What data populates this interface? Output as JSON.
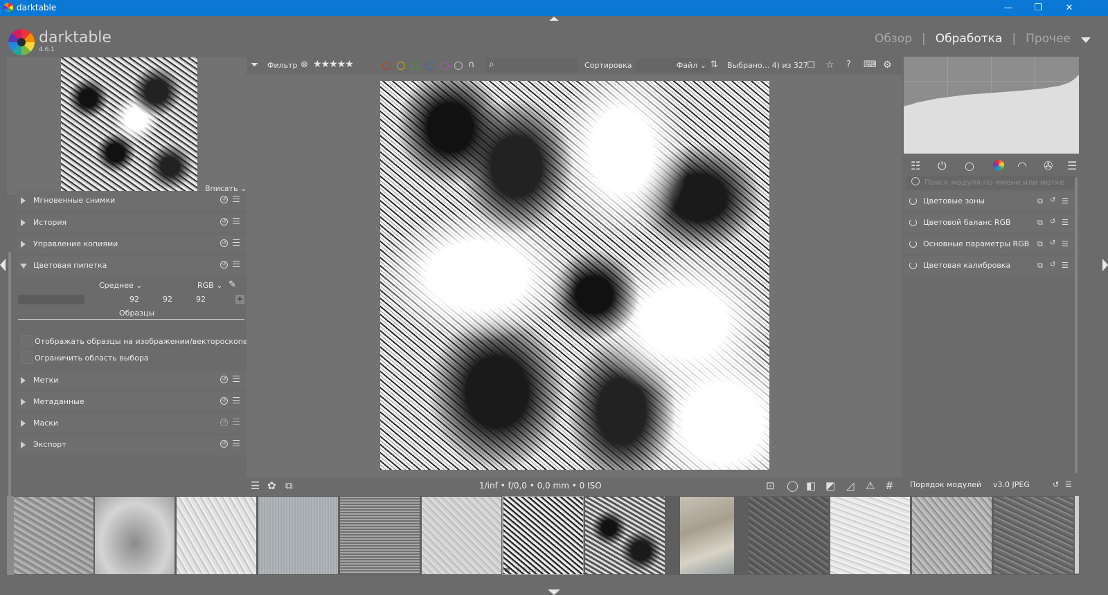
{
  "window": {
    "title": "darktable",
    "buttons": [
      "—",
      "❐",
      "✕"
    ]
  },
  "header": {
    "brand": "darktable",
    "version": "4.6.1",
    "views": [
      {
        "label": "Обзор",
        "active": false
      },
      {
        "label": "Обработка",
        "active": true
      },
      {
        "label": "Прочее",
        "active": false
      }
    ],
    "separator": "|"
  },
  "left": {
    "zoom_label": "Вписать",
    "modules_top": [
      {
        "label": "Мгновенные снимки"
      },
      {
        "label": "История"
      },
      {
        "label": "Управление копиями"
      },
      {
        "label": "Цветовая пипетка",
        "open": true
      }
    ],
    "color_picker": {
      "mode": "Среднее",
      "colorspace": "RGB",
      "values": [
        "92",
        "92",
        "92"
      ],
      "samples_label": "Образцы",
      "options": [
        "Отображать образцы на изображении/вектороскопе",
        "Ограничить область выбора"
      ]
    },
    "modules_bottom": [
      {
        "label": "Метки"
      },
      {
        "label": "Метаданные"
      },
      {
        "label": "Маски"
      },
      {
        "label": "Экспорт"
      }
    ]
  },
  "filterbar": {
    "filter_label": "Фильтр",
    "rating": "★★★★★",
    "sort_label": "Сортировка",
    "sort_value": "Файл",
    "selection": "Выбрано... 4) из 327",
    "color_labels": [
      "#c0392b",
      "#c9a227",
      "#3e9a3e",
      "#3b63b8",
      "#a85aa8",
      "#bcbcbc"
    ]
  },
  "center": {
    "exif": "1/inf • f/0,0 • 0,0 mm • 0 ISO"
  },
  "right": {
    "search_placeholder": "Поиск модуля по имени или метке",
    "modules": [
      {
        "label": "Цветовые зоны"
      },
      {
        "label": "Цветовой баланс RGB"
      },
      {
        "label": "Основные параметры RGB"
      },
      {
        "label": "Цветовая калибровка"
      }
    ],
    "module_order_label": "Порядок модулей",
    "module_order_value": "v3.0 JPEG"
  },
  "filmstrip": {
    "stars": "☆☆☆☆☆",
    "reject": "⊗"
  },
  "icons": {
    "filter": "funnel-icon",
    "search": "search-icon",
    "star": "star-icon",
    "help": "help-icon",
    "keyboard": "keyboard-icon",
    "settings": "gear-icon"
  }
}
